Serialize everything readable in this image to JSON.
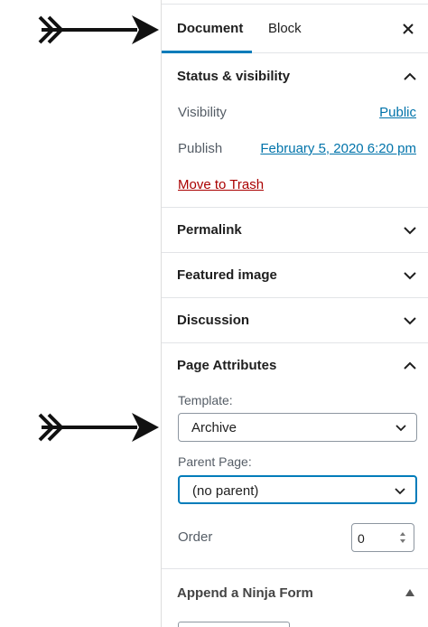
{
  "tabs": {
    "document": "Document",
    "block": "Block"
  },
  "icons": {
    "close": "close-icon",
    "chevron_up": "chevron-up-icon",
    "chevron_down": "chevron-down-icon",
    "arrow": "arrow-right-icon"
  },
  "status_visibility": {
    "title": "Status & visibility",
    "visibility_label": "Visibility",
    "visibility_value": "Public",
    "publish_label": "Publish",
    "publish_value": "February 5, 2020 6:20 pm",
    "trash_label": "Move to Trash"
  },
  "panels": {
    "permalink": "Permalink",
    "featured_image": "Featured image",
    "discussion": "Discussion"
  },
  "page_attributes": {
    "title": "Page Attributes",
    "template_label": "Template:",
    "template_value": "Archive",
    "parent_label": "Parent Page:",
    "parent_value": "(no parent)",
    "order_label": "Order",
    "order_value": "0"
  },
  "ninja_form": {
    "title": "Append a Ninja Form"
  },
  "colors": {
    "accent": "#007cba",
    "link": "#0073aa",
    "danger": "#aa0000"
  }
}
